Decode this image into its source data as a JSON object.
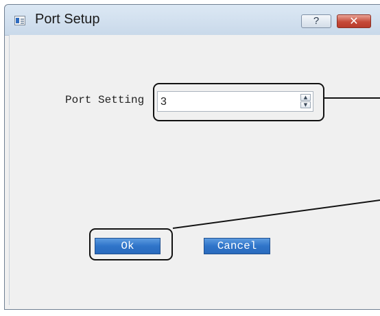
{
  "window": {
    "title": "Port Setup",
    "help_label": "?",
    "close_label": "✕"
  },
  "form": {
    "port_label": "Port Setting",
    "port_value": "3",
    "spin_up": "▲",
    "spin_down": "▼"
  },
  "buttons": {
    "ok_label": "Ok",
    "cancel_label": "Cancel"
  },
  "icons": {
    "app_icon": "window-app-icon",
    "help_icon": "help-icon",
    "close_icon": "close-icon"
  },
  "colors": {
    "button_blue": "#2f74c9",
    "close_red": "#c64a39",
    "title_bar": "#dce8f4"
  }
}
